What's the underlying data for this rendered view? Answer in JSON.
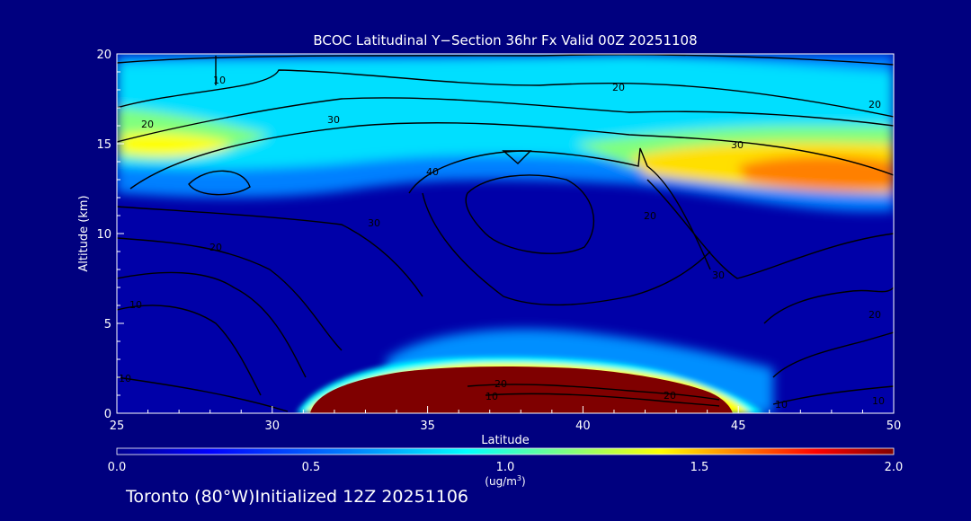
{
  "chart_data": {
    "type": "heatmap",
    "title": "BCOC Latitudinal Y−Section 36hr  Fx Valid 00Z 20251108",
    "xlabel": "Latitude",
    "ylabel": "Altitude (km)",
    "xlim": [
      25,
      50
    ],
    "ylim": [
      0,
      20
    ],
    "x_ticks": [
      "25",
      "30",
      "35",
      "40",
      "45",
      "50"
    ],
    "y_ticks": [
      "0",
      "5",
      "10",
      "15",
      "20"
    ],
    "colorbar": {
      "label": "(ug/m",
      "label_superscript": "3",
      "label_close": ")",
      "range": [
        0.0,
        2.0
      ],
      "ticks": [
        "0.0",
        "0.5",
        "1.0",
        "1.5",
        "2.0"
      ],
      "colors": [
        "#00008f",
        "#0000ff",
        "#007fff",
        "#00ffff",
        "#7fff7f",
        "#ffff00",
        "#ff7f00",
        "#ff0000",
        "#7f0000"
      ]
    },
    "contour_labels": [
      "10",
      "20",
      "30",
      "40"
    ],
    "field_regions": [
      {
        "name": "surface-plume",
        "lat_range": [
          31,
          45
        ],
        "alt_range": [
          0,
          2.3
        ],
        "peak_value": 2.0
      },
      {
        "name": "upper-layer-north",
        "lat_range": [
          40,
          50
        ],
        "alt_range": [
          11,
          17
        ],
        "peak_value": 1.55
      },
      {
        "name": "upper-layer-south",
        "lat_range": [
          25,
          30
        ],
        "alt_range": [
          12.5,
          16
        ],
        "peak_value": 1.3
      },
      {
        "name": "upper-cyan-band",
        "lat_range": [
          25,
          50
        ],
        "alt_range": [
          12,
          19
        ],
        "peak_value": 0.9
      }
    ]
  },
  "footer_text": "Toronto (80°W)Initialized 12Z 20251106"
}
